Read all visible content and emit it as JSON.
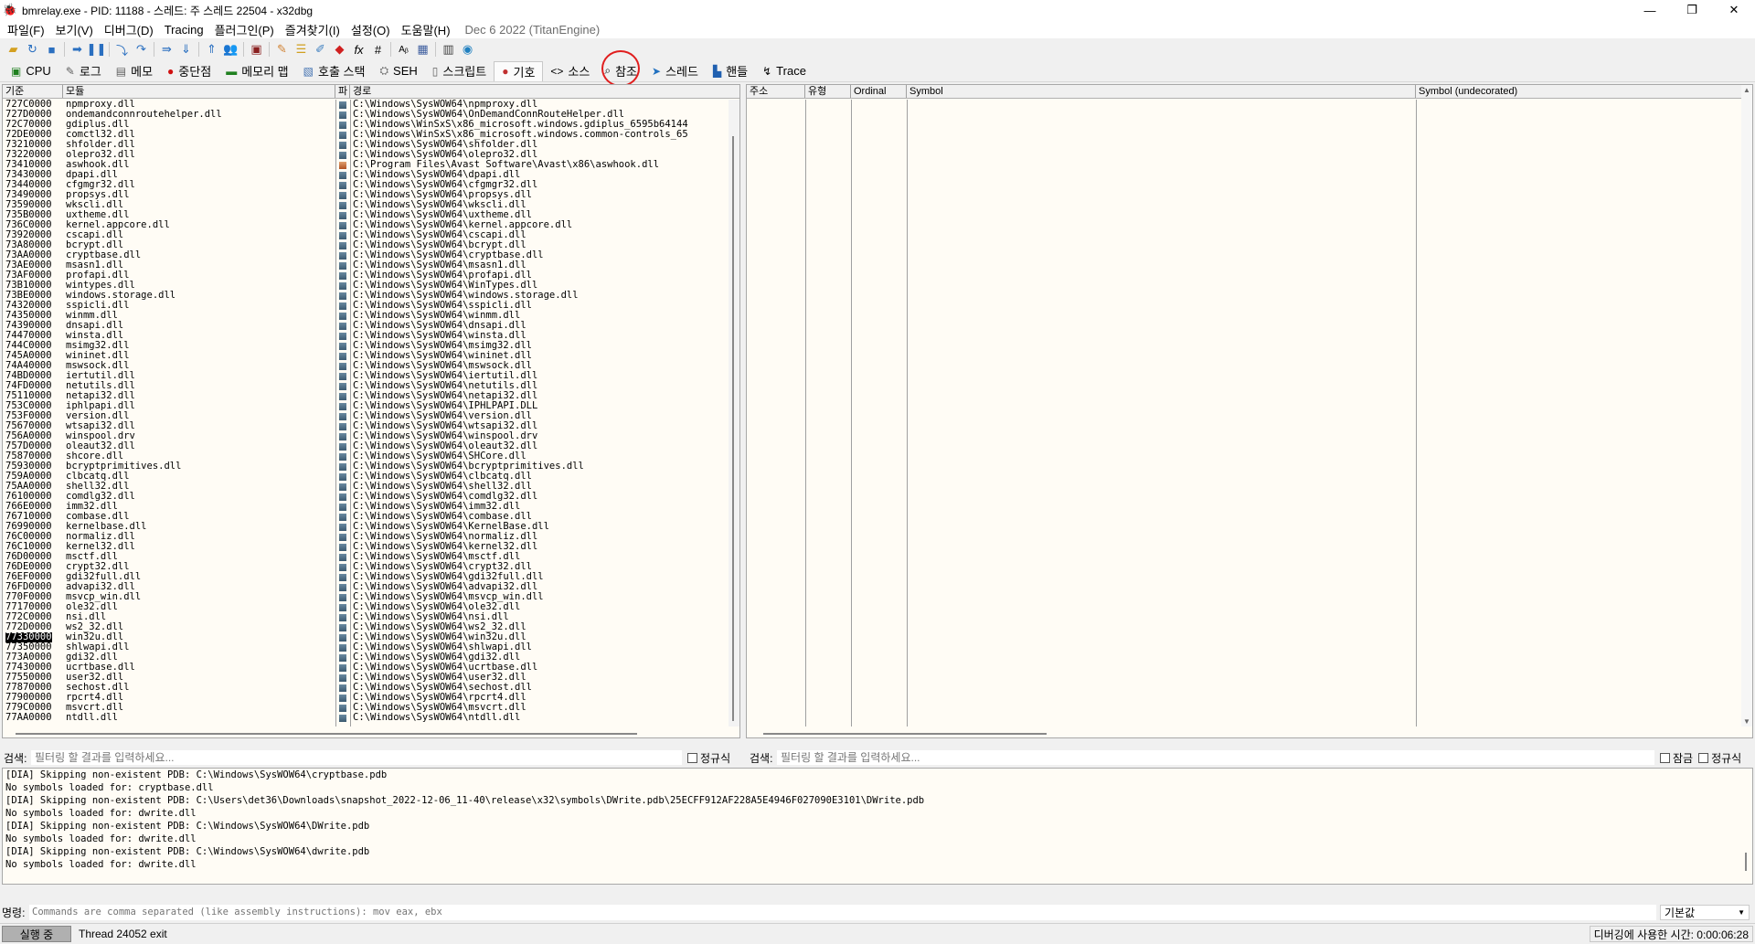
{
  "window": {
    "title": "bmrelay.exe - PID: 11188 - 스레드: 주 스레드 22504 - x32dbg",
    "minimize": "—",
    "maximize": "❐",
    "close": "✕"
  },
  "menu": {
    "items": [
      "파일(F)",
      "보기(V)",
      "디버그(D)",
      "Tracing",
      "플러그인(P)",
      "즐겨찾기(I)",
      "설정(O)",
      "도움말(H)"
    ],
    "build_info": "Dec 6 2022 (TitanEngine)"
  },
  "toolbar": {
    "icons": [
      "open-icon",
      "restart-icon",
      "stop-icon",
      "run-icon",
      "pause-icon",
      "step-into-icon",
      "step-over-icon",
      "trace-into-icon",
      "trace-over-icon",
      "execute-till-return-icon",
      "run-to-user-code-icon",
      "scylla-icon",
      "patch-icon",
      "comments-icon",
      "labels-icon",
      "bookmarks-icon",
      "functions-icon",
      "variables-icon",
      "strings-icon",
      "calculator-icon",
      "memory-icon",
      "help-icon"
    ]
  },
  "tabs": [
    {
      "label": "CPU",
      "icon": "cpu-icon"
    },
    {
      "label": "로그",
      "icon": "log-icon"
    },
    {
      "label": "메모",
      "icon": "notes-icon"
    },
    {
      "label": "중단점",
      "icon": "breakpoint-icon"
    },
    {
      "label": "메모리 맵",
      "icon": "memory-map-icon"
    },
    {
      "label": "호출 스택",
      "icon": "call-stack-icon"
    },
    {
      "label": "SEH",
      "icon": "seh-icon"
    },
    {
      "label": "스크립트",
      "icon": "script-icon"
    },
    {
      "label": "기호",
      "icon": "symbols-icon"
    },
    {
      "label": "소스",
      "icon": "source-icon"
    },
    {
      "label": "참조",
      "icon": "references-icon"
    },
    {
      "label": "스레드",
      "icon": "threads-icon"
    },
    {
      "label": "핸들",
      "icon": "handles-icon"
    },
    {
      "label": "Trace",
      "icon": "trace-icon"
    }
  ],
  "modules": {
    "headers": {
      "base": "기준",
      "module": "모듈",
      "party": "파",
      "path": "경로"
    },
    "rows": [
      [
        "727C0000",
        "npmproxy.dll",
        "sys",
        "C:\\Windows\\SysWOW64\\npmproxy.dll"
      ],
      [
        "727D0000",
        "ondemandconnroutehelper.dll",
        "sys",
        "C:\\Windows\\SysWOW64\\OnDemandConnRouteHelper.dll"
      ],
      [
        "72C70000",
        "gdiplus.dll",
        "sys",
        "C:\\Windows\\WinSxS\\x86_microsoft.windows.gdiplus_6595b64144"
      ],
      [
        "72DE0000",
        "comctl32.dll",
        "sys",
        "C:\\Windows\\WinSxS\\x86_microsoft.windows.common-controls_65"
      ],
      [
        "73210000",
        "shfolder.dll",
        "sys",
        "C:\\Windows\\SysWOW64\\shfolder.dll"
      ],
      [
        "73220000",
        "olepro32.dll",
        "sys",
        "C:\\Windows\\SysWOW64\\olepro32.dll"
      ],
      [
        "73410000",
        "aswhook.dll",
        "user",
        "C:\\Program Files\\Avast Software\\Avast\\x86\\aswhook.dll"
      ],
      [
        "73430000",
        "dpapi.dll",
        "sys",
        "C:\\Windows\\SysWOW64\\dpapi.dll"
      ],
      [
        "73440000",
        "cfgmgr32.dll",
        "sys",
        "C:\\Windows\\SysWOW64\\cfgmgr32.dll"
      ],
      [
        "73490000",
        "propsys.dll",
        "sys",
        "C:\\Windows\\SysWOW64\\propsys.dll"
      ],
      [
        "73590000",
        "wkscli.dll",
        "sys",
        "C:\\Windows\\SysWOW64\\wkscli.dll"
      ],
      [
        "735B0000",
        "uxtheme.dll",
        "sys",
        "C:\\Windows\\SysWOW64\\uxtheme.dll"
      ],
      [
        "736C0000",
        "kernel.appcore.dll",
        "sys",
        "C:\\Windows\\SysWOW64\\kernel.appcore.dll"
      ],
      [
        "73920000",
        "cscapi.dll",
        "sys",
        "C:\\Windows\\SysWOW64\\cscapi.dll"
      ],
      [
        "73A80000",
        "bcrypt.dll",
        "sys",
        "C:\\Windows\\SysWOW64\\bcrypt.dll"
      ],
      [
        "73AA0000",
        "cryptbase.dll",
        "sys",
        "C:\\Windows\\SysWOW64\\cryptbase.dll"
      ],
      [
        "73AE0000",
        "msasn1.dll",
        "sys",
        "C:\\Windows\\SysWOW64\\msasn1.dll"
      ],
      [
        "73AF0000",
        "profapi.dll",
        "sys",
        "C:\\Windows\\SysWOW64\\profapi.dll"
      ],
      [
        "73B10000",
        "wintypes.dll",
        "sys",
        "C:\\Windows\\SysWOW64\\WinTypes.dll"
      ],
      [
        "73BE0000",
        "windows.storage.dll",
        "sys",
        "C:\\Windows\\SysWOW64\\windows.storage.dll"
      ],
      [
        "74320000",
        "sspicli.dll",
        "sys",
        "C:\\Windows\\SysWOW64\\sspicli.dll"
      ],
      [
        "74350000",
        "winmm.dll",
        "sys",
        "C:\\Windows\\SysWOW64\\winmm.dll"
      ],
      [
        "74390000",
        "dnsapi.dll",
        "sys",
        "C:\\Windows\\SysWOW64\\dnsapi.dll"
      ],
      [
        "74470000",
        "winsta.dll",
        "sys",
        "C:\\Windows\\SysWOW64\\winsta.dll"
      ],
      [
        "744C0000",
        "msimg32.dll",
        "sys",
        "C:\\Windows\\SysWOW64\\msimg32.dll"
      ],
      [
        "745A0000",
        "wininet.dll",
        "sys",
        "C:\\Windows\\SysWOW64\\wininet.dll"
      ],
      [
        "74A40000",
        "mswsock.dll",
        "sys",
        "C:\\Windows\\SysWOW64\\mswsock.dll"
      ],
      [
        "74BD0000",
        "iertutil.dll",
        "sys",
        "C:\\Windows\\SysWOW64\\iertutil.dll"
      ],
      [
        "74FD0000",
        "netutils.dll",
        "sys",
        "C:\\Windows\\SysWOW64\\netutils.dll"
      ],
      [
        "75110000",
        "netapi32.dll",
        "sys",
        "C:\\Windows\\SysWOW64\\netapi32.dll"
      ],
      [
        "753C0000",
        "iphlpapi.dll",
        "sys",
        "C:\\Windows\\SysWOW64\\IPHLPAPI.DLL"
      ],
      [
        "753F0000",
        "version.dll",
        "sys",
        "C:\\Windows\\SysWOW64\\version.dll"
      ],
      [
        "75670000",
        "wtsapi32.dll",
        "sys",
        "C:\\Windows\\SysWOW64\\wtsapi32.dll"
      ],
      [
        "756A0000",
        "winspool.drv",
        "sys",
        "C:\\Windows\\SysWOW64\\winspool.drv"
      ],
      [
        "757D0000",
        "oleaut32.dll",
        "sys",
        "C:\\Windows\\SysWOW64\\oleaut32.dll"
      ],
      [
        "75870000",
        "shcore.dll",
        "sys",
        "C:\\Windows\\SysWOW64\\SHCore.dll"
      ],
      [
        "75930000",
        "bcryptprimitives.dll",
        "sys",
        "C:\\Windows\\SysWOW64\\bcryptprimitives.dll"
      ],
      [
        "759A0000",
        "clbcatq.dll",
        "sys",
        "C:\\Windows\\SysWOW64\\clbcatq.dll"
      ],
      [
        "75AA0000",
        "shell32.dll",
        "sys",
        "C:\\Windows\\SysWOW64\\shell32.dll"
      ],
      [
        "76100000",
        "comdlg32.dll",
        "sys",
        "C:\\Windows\\SysWOW64\\comdlg32.dll"
      ],
      [
        "766E0000",
        "imm32.dll",
        "sys",
        "C:\\Windows\\SysWOW64\\imm32.dll"
      ],
      [
        "76710000",
        "combase.dll",
        "sys",
        "C:\\Windows\\SysWOW64\\combase.dll"
      ],
      [
        "76990000",
        "kernelbase.dll",
        "sys",
        "C:\\Windows\\SysWOW64\\KernelBase.dll"
      ],
      [
        "76C00000",
        "normaliz.dll",
        "sys",
        "C:\\Windows\\SysWOW64\\normaliz.dll"
      ],
      [
        "76C10000",
        "kernel32.dll",
        "sys",
        "C:\\Windows\\SysWOW64\\kernel32.dll"
      ],
      [
        "76D00000",
        "msctf.dll",
        "sys",
        "C:\\Windows\\SysWOW64\\msctf.dll"
      ],
      [
        "76DE0000",
        "crypt32.dll",
        "sys",
        "C:\\Windows\\SysWOW64\\crypt32.dll"
      ],
      [
        "76EF0000",
        "gdi32full.dll",
        "sys",
        "C:\\Windows\\SysWOW64\\gdi32full.dll"
      ],
      [
        "76FD0000",
        "advapi32.dll",
        "sys",
        "C:\\Windows\\SysWOW64\\advapi32.dll"
      ],
      [
        "770F0000",
        "msvcp_win.dll",
        "sys",
        "C:\\Windows\\SysWOW64\\msvcp_win.dll"
      ],
      [
        "77170000",
        "ole32.dll",
        "sys",
        "C:\\Windows\\SysWOW64\\ole32.dll"
      ],
      [
        "772C0000",
        "nsi.dll",
        "sys",
        "C:\\Windows\\SysWOW64\\nsi.dll"
      ],
      [
        "772D0000",
        "ws2_32.dll",
        "sys",
        "C:\\Windows\\SysWOW64\\ws2_32.dll"
      ],
      [
        "77330000",
        "win32u.dll",
        "sys",
        "C:\\Windows\\SysWOW64\\win32u.dll"
      ],
      [
        "77350000",
        "shlwapi.dll",
        "sys",
        "C:\\Windows\\SysWOW64\\shlwapi.dll"
      ],
      [
        "773A0000",
        "gdi32.dll",
        "sys",
        "C:\\Windows\\SysWOW64\\gdi32.dll"
      ],
      [
        "77430000",
        "ucrtbase.dll",
        "sys",
        "C:\\Windows\\SysWOW64\\ucrtbase.dll"
      ],
      [
        "77550000",
        "user32.dll",
        "sys",
        "C:\\Windows\\SysWOW64\\user32.dll"
      ],
      [
        "77870000",
        "sechost.dll",
        "sys",
        "C:\\Windows\\SysWOW64\\sechost.dll"
      ],
      [
        "77900000",
        "rpcrt4.dll",
        "sys",
        "C:\\Windows\\SysWOW64\\rpcrt4.dll"
      ],
      [
        "779C0000",
        "msvcrt.dll",
        "sys",
        "C:\\Windows\\SysWOW64\\msvcrt.dll"
      ],
      [
        "77AA0000",
        "ntdll.dll",
        "sys",
        "C:\\Windows\\SysWOW64\\ntdll.dll"
      ]
    ],
    "selected_base": "77330000"
  },
  "symbols": {
    "headers": {
      "address": "주소",
      "type": "유형",
      "ordinal": "Ordinal",
      "symbol": "Symbol",
      "undecorated": "Symbol (undecorated)"
    }
  },
  "search": {
    "left_label": "검색:",
    "left_placeholder": "필터링 할 결과를 입력하세요...",
    "left_regex": "정규식",
    "right_label": "검색:",
    "right_placeholder": "필터링 할 결과를 입력하세요...",
    "right_lock": "잠금",
    "right_regex": "정규식"
  },
  "log": {
    "lines": [
      "[DIA] Skipping non-existent PDB: C:\\Windows\\SysWOW64\\cryptbase.pdb",
      "No symbols loaded for: cryptbase.dll",
      "[DIA] Skipping non-existent PDB: C:\\Users\\det36\\Downloads\\snapshot_2022-12-06_11-40\\release\\x32\\symbols\\DWrite.pdb\\25ECFF912AF228A5E4946F027090E3101\\DWrite.pdb",
      "No symbols loaded for: dwrite.dll",
      "[DIA] Skipping non-existent PDB: C:\\Windows\\SysWOW64\\DWrite.pdb",
      "No symbols loaded for: dwrite.dll",
      "[DIA] Skipping non-existent PDB: C:\\Windows\\SysWOW64\\dwrite.pdb",
      "No symbols loaded for: dwrite.dll"
    ]
  },
  "command": {
    "label": "명령:",
    "placeholder": "Commands are comma separated (like assembly instructions): mov eax, ebx",
    "default_value": "기본값"
  },
  "status": {
    "state": "실행 중",
    "message": "Thread 24052 exit",
    "time": "디버깅에 사용한 시간: 0:00:06:28"
  },
  "colors": {
    "pane_bg": "#fffcf5",
    "annotation": "#e01e1e",
    "selected_bg": "#000000"
  }
}
